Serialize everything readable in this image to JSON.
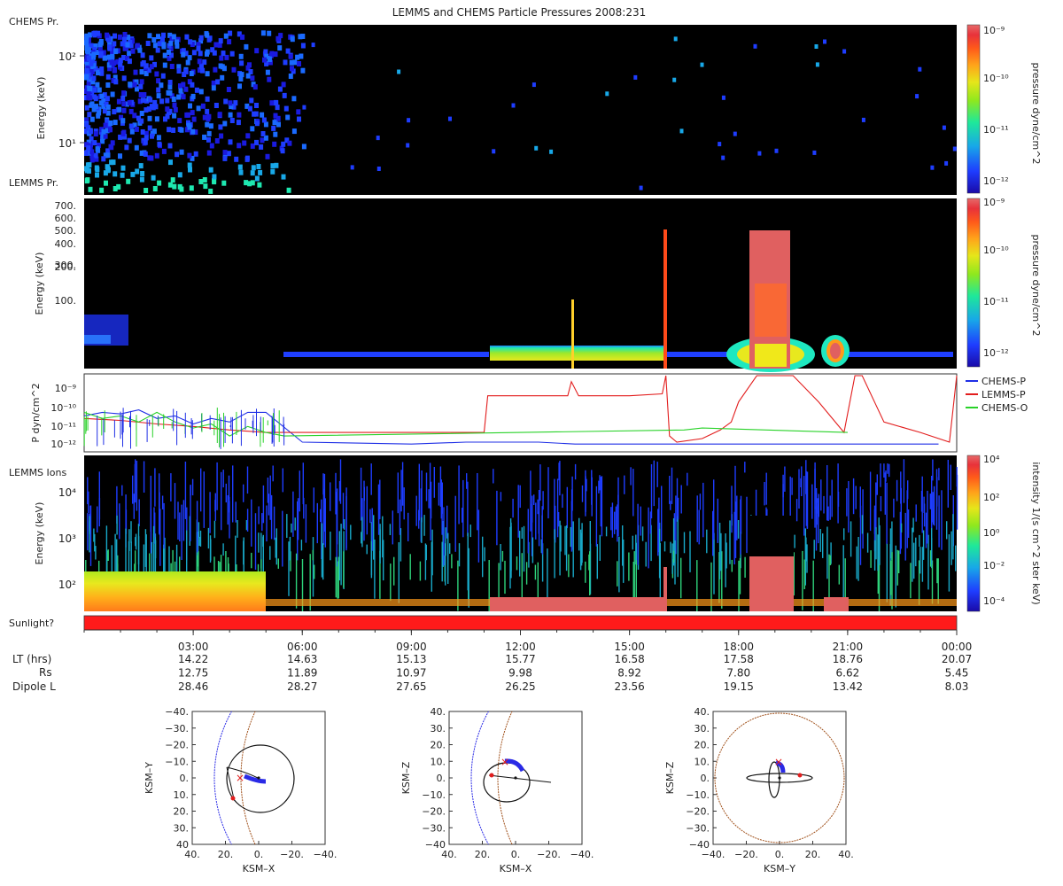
{
  "title": "LEMMS and CHEMS Particle Pressures  2008:231",
  "panels": {
    "chems": {
      "label": "CHEMS Pr.",
      "ylabel": "Energy (keV)",
      "yticks": [
        "10²",
        "10¹"
      ],
      "colorbar": {
        "label": "pressure dyne/cm^2",
        "ticks": [
          "10⁻⁹",
          "10⁻¹⁰",
          "10⁻¹¹",
          "10⁻¹²"
        ]
      }
    },
    "lemms_pr": {
      "label": "LEMMS Pr.",
      "ylabel": "Energy (keV)",
      "yticks": [
        "700.",
        "600.",
        "500.",
        "400.",
        "300.",
        "200.",
        "100."
      ],
      "colorbar": {
        "label": "pressure dyne/cm^2",
        "ticks": [
          "10⁻⁹",
          "10⁻¹⁰",
          "10⁻¹¹",
          "10⁻¹²"
        ]
      }
    },
    "pressure": {
      "ylabel": "P dyn/cm^2",
      "yticks": [
        "10⁻⁹",
        "10⁻¹⁰",
        "10⁻¹¹",
        "10⁻¹²"
      ]
    },
    "lemms_ions": {
      "label": "LEMMS Ions",
      "ylabel": "Energy (keV)",
      "yticks": [
        "10⁴",
        "10³",
        "10²"
      ],
      "colorbar": {
        "label": "intensity 1/(s cm^2 ster keV)",
        "ticks": [
          "10⁴",
          "10²",
          "10⁰",
          "10⁻²",
          "10⁻⁴"
        ]
      }
    },
    "sunlight": {
      "label": "Sunlight?"
    }
  },
  "time_axis": {
    "ticks": [
      "03:00",
      "06:00",
      "09:00",
      "12:00",
      "15:00",
      "18:00",
      "21:00",
      "00:00"
    ],
    "rows": [
      {
        "label": "LT (hrs)",
        "values": [
          "14.22",
          "14.63",
          "15.13",
          "15.77",
          "16.58",
          "17.58",
          "18.76",
          "20.07"
        ]
      },
      {
        "label": "Rs",
        "values": [
          "12.75",
          "11.89",
          "10.97",
          "9.98",
          "8.92",
          "7.80",
          "6.62",
          "5.45"
        ]
      },
      {
        "label": "Dipole L",
        "values": [
          "28.46",
          "28.27",
          "27.65",
          "26.25",
          "23.56",
          "19.15",
          "13.42",
          "8.03"
        ]
      }
    ]
  },
  "orbits": [
    {
      "xlabel": "KSM–X",
      "ylabel": "KSM–Y",
      "xticks": [
        "40.",
        "20.",
        "0.",
        "−20.",
        "−40."
      ],
      "yticks": [
        "−40.",
        "−30.",
        "−20.",
        "−10.",
        "0.",
        "10.",
        "20.",
        "30.",
        "40"
      ]
    },
    {
      "xlabel": "KSM–X",
      "ylabel": "KSM–Z",
      "xticks": [
        "40.",
        "20.",
        "0.",
        "−20.",
        "−40."
      ],
      "yticks": [
        "40.",
        "30.",
        "20.",
        "10.",
        "0.",
        "−10.",
        "−20.",
        "−30.",
        "−40"
      ]
    },
    {
      "xlabel": "KSM–Y",
      "ylabel": "KSM–Z",
      "xticks": [
        "−40.",
        "−20.",
        "0.",
        "20.",
        "40."
      ],
      "yticks": [
        "40.",
        "30.",
        "20.",
        "10.",
        "0.",
        "−10.",
        "−20.",
        "−30.",
        "−40"
      ]
    }
  ],
  "chart_data": [
    {
      "type": "line",
      "yscale": "log",
      "ylim": [
        4e-13,
        2e-09
      ],
      "xlim": [
        0,
        24
      ],
      "ylabel": "P dyn/cm^2",
      "legend_position": "right",
      "series": [
        {
          "name": "CHEMS-P",
          "color": "#1f2fe6",
          "x": [
            0.0,
            0.5,
            1.0,
            1.5,
            2.0,
            2.5,
            3.0,
            3.5,
            4.0,
            4.5,
            5.0,
            6.0,
            9.0,
            10.5,
            12.5,
            13.5,
            15.0,
            16.0,
            17.0,
            19.0,
            21.0,
            23.5
          ],
          "y": [
            2e-11,
            3e-11,
            2.5e-11,
            4e-11,
            1.5e-11,
            2e-11,
            8e-12,
            1.5e-11,
            1e-11,
            3e-11,
            3e-11,
            1e-12,
            8e-13,
            1e-12,
            1e-12,
            8e-13,
            8e-13,
            8e-13,
            8e-13,
            8e-13,
            8e-13,
            8e-13
          ]
        },
        {
          "name": "LEMMS-P",
          "color": "#e21d1d",
          "x": [
            0.0,
            1.0,
            2.0,
            3.0,
            4.0,
            5.0,
            6.0,
            8.0,
            10.0,
            11.0,
            11.1,
            12.0,
            13.3,
            13.4,
            13.6,
            15.0,
            15.9,
            16.0,
            16.1,
            16.3,
            17.0,
            17.5,
            17.8,
            18.0,
            18.5,
            19.5,
            20.2,
            20.9,
            21.2,
            21.4,
            22.0,
            23.0,
            23.8,
            24.0
          ],
          "y": [
            1.5e-11,
            1.2e-11,
            8e-12,
            6e-12,
            4e-12,
            3e-12,
            3e-12,
            3e-12,
            3e-12,
            3e-12,
            2e-10,
            2e-10,
            2e-10,
            1e-09,
            2e-10,
            2e-10,
            2.5e-10,
            2e-09,
            2e-12,
            1e-12,
            1.5e-12,
            4e-12,
            1e-11,
            1e-10,
            2e-09,
            2e-09,
            1e-10,
            3e-12,
            2e-09,
            2e-09,
            1e-11,
            3e-12,
            1e-12,
            2e-09
          ]
        },
        {
          "name": "CHEMS-O",
          "color": "#28d228",
          "x": [
            0.0,
            0.5,
            1.0,
            1.5,
            2.0,
            2.5,
            3.0,
            3.5,
            4.0,
            4.5,
            5.0,
            5.5,
            16.5,
            17.0,
            21.0
          ],
          "y": [
            3e-11,
            1.5e-11,
            2e-11,
            1e-11,
            3e-11,
            1e-11,
            5e-12,
            8e-12,
            2e-12,
            6e-12,
            3e-12,
            2e-12,
            4e-12,
            5e-12,
            3e-12
          ]
        }
      ]
    },
    {
      "type": "heatmap",
      "panel": "CHEMS Pr.",
      "yscale": "log",
      "ylim": [
        3,
        250
      ],
      "features": [
        {
          "x0": 0.0,
          "x1": 6.0,
          "y0": 3,
          "y1": 200,
          "level": -12,
          "note": "scattered"
        },
        {
          "x0": 0.0,
          "x1": 6.0,
          "y0": 3,
          "y1": 6,
          "level": -11.5
        }
      ]
    },
    {
      "type": "heatmap",
      "panel": "LEMMS Pr.",
      "ylim": [
        25,
        750
      ],
      "features": [
        {
          "x0": 0.0,
          "x1": 1.3,
          "y0": 28,
          "y1": 75,
          "level": -12
        },
        {
          "x0": 5.5,
          "x1": 11.0,
          "y0": 29,
          "y1": 34,
          "level": -12
        },
        {
          "x0": 11.0,
          "x1": 16.0,
          "y0": 28,
          "y1": 38,
          "level": -10.7
        },
        {
          "x0": 13.4,
          "x1": 13.5,
          "y0": 28,
          "y1": 110,
          "level": -10
        },
        {
          "x0": 16.0,
          "x1": 16.1,
          "y0": 28,
          "y1": 430,
          "level": -9.2
        },
        {
          "x0": 18.3,
          "x1": 19.6,
          "y0": 28,
          "y1": 400,
          "level": -9
        },
        {
          "x0": 20.5,
          "x1": 21.1,
          "y0": 28,
          "y1": 50,
          "level": -10
        }
      ]
    },
    {
      "type": "heatmap",
      "panel": "LEMMS Ions",
      "yscale": "log",
      "ylim": [
        30,
        70000
      ],
      "features": [
        {
          "x0": 0.0,
          "x1": 24.0,
          "y0": 30,
          "y1": 60000,
          "level": -4,
          "note": "noise"
        },
        {
          "x0": 0.0,
          "x1": 5.5,
          "y0": 40,
          "y1": 160,
          "level": 1.5
        },
        {
          "x0": 11.0,
          "x1": 16.0,
          "y0": 30,
          "y1": 45,
          "level": 4
        },
        {
          "x0": 18.3,
          "x1": 19.6,
          "y0": 30,
          "y1": 300,
          "level": 4
        }
      ]
    }
  ]
}
